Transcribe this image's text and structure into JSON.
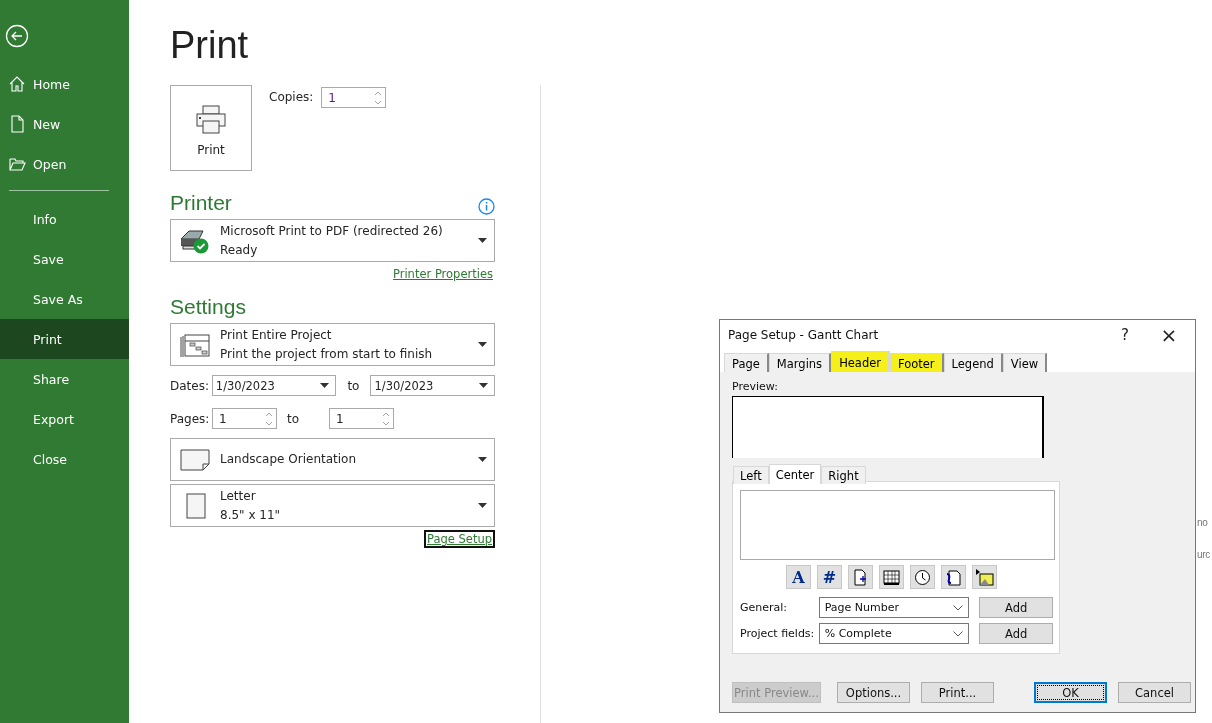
{
  "sidebar": {
    "items": [
      {
        "label": "Home",
        "kind": "home",
        "selected": false
      },
      {
        "label": "New",
        "kind": "new",
        "selected": false
      },
      {
        "label": "Open",
        "kind": "open",
        "selected": false,
        "divider_after": true
      },
      {
        "label": "Info",
        "selected": false
      },
      {
        "label": "Save",
        "selected": false
      },
      {
        "label": "Save As",
        "selected": false
      },
      {
        "label": "Print",
        "selected": true
      },
      {
        "label": "Share",
        "selected": false
      },
      {
        "label": "Export",
        "selected": false
      },
      {
        "label": "Close",
        "selected": false
      }
    ]
  },
  "title": "Print",
  "print_button": "Print",
  "copies": {
    "label": "Copies:",
    "value": "1"
  },
  "printer": {
    "heading": "Printer",
    "name": "Microsoft Print to PDF (redirected 26)",
    "status": "Ready",
    "properties_link": "Printer Properties"
  },
  "settings": {
    "heading": "Settings",
    "dropdowns": [
      {
        "kind": "gantt",
        "title": "Print Entire Project",
        "subtitle": "Print the project from start to finish"
      }
    ],
    "dates": {
      "label": "Dates:",
      "from": "1/30/2023",
      "to_label": "to",
      "to": "1/30/2023"
    },
    "pages": {
      "label": "Pages:",
      "from": "1",
      "to_label": "to",
      "to": "1"
    },
    "more_dropdowns": [
      {
        "kind": "landscape",
        "title": "Landscape Orientation"
      },
      {
        "kind": "portrait",
        "title": "Letter",
        "subtitle": "8.5\" x 11\""
      }
    ],
    "page_setup_link": "Page Setup"
  },
  "background_fragments": [
    "no",
    "urc"
  ],
  "dialog": {
    "title": "Page Setup - Gantt Chart",
    "help": "?",
    "close": "×",
    "tabs": [
      {
        "label": "Page",
        "selected": false,
        "highlighted": false
      },
      {
        "label": "Margins",
        "selected": false,
        "highlighted": false
      },
      {
        "label": "Header",
        "selected": true,
        "highlighted": true
      },
      {
        "label": "Footer",
        "selected": false,
        "highlighted": true
      },
      {
        "label": "Legend",
        "selected": false,
        "highlighted": false
      },
      {
        "label": "View",
        "selected": false,
        "highlighted": false
      }
    ],
    "preview_label": "Preview:",
    "alignment_tabs": [
      {
        "label": "Left",
        "selected": false
      },
      {
        "label": "Center",
        "selected": true
      },
      {
        "label": "Right",
        "selected": false
      }
    ],
    "toolbar": [
      {
        "kind": "glyph",
        "glyph": "A"
      },
      {
        "kind": "glyph",
        "glyph": "#"
      },
      {
        "kind": "page-count"
      },
      {
        "kind": "date"
      },
      {
        "kind": "time"
      },
      {
        "kind": "file"
      },
      {
        "kind": "picture"
      }
    ],
    "fields": [
      {
        "label": "General:",
        "value": "Page Number",
        "button": "Add"
      },
      {
        "label": "Project fields:",
        "value": "% Complete",
        "button": "Add"
      }
    ],
    "buttons": [
      {
        "label": "Print Preview...",
        "disabled": true,
        "default": false
      },
      {
        "label": "Options...",
        "disabled": false,
        "default": false
      },
      {
        "label": "Print...",
        "disabled": false,
        "default": false
      },
      {
        "label": "OK",
        "disabled": false,
        "default": true
      },
      {
        "label": "Cancel",
        "disabled": false,
        "default": false
      }
    ]
  }
}
